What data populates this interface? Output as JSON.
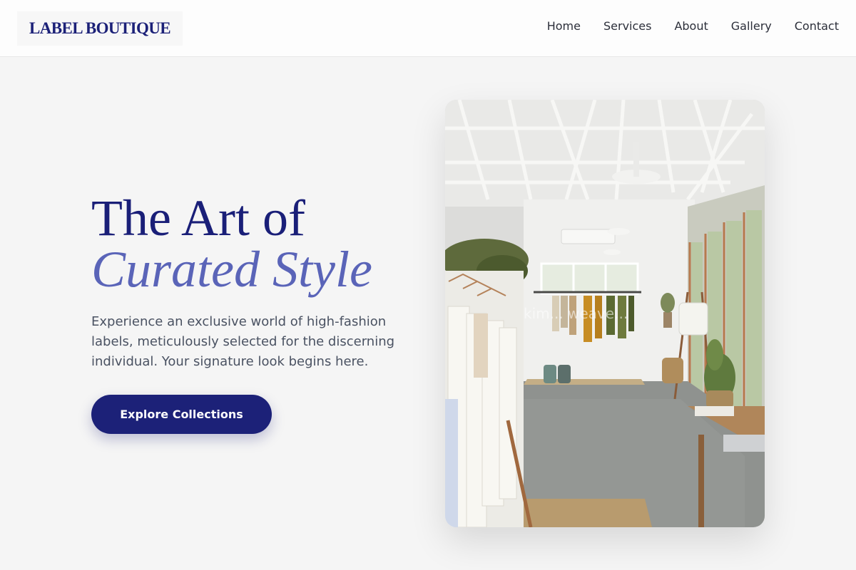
{
  "brand": {
    "logo_text": "LABEL BOUTIQUE"
  },
  "nav": {
    "items": [
      {
        "label": "Home"
      },
      {
        "label": "Services"
      },
      {
        "label": "About"
      },
      {
        "label": "Gallery"
      },
      {
        "label": "Contact"
      }
    ]
  },
  "hero": {
    "title_line1": "The Art of",
    "title_line2": "Curated Style",
    "description": "Experience an exclusive world of high-fashion labels, meticulously selected for the discerning individual. Your signature look begins here.",
    "cta_label": "Explore Collections",
    "image_watermark": "kim... weave..."
  },
  "colors": {
    "brand_navy": "#1c2178",
    "accent_periwinkle": "#5a64b8",
    "page_background": "#f5f5f5",
    "body_text": "#4a5262"
  }
}
